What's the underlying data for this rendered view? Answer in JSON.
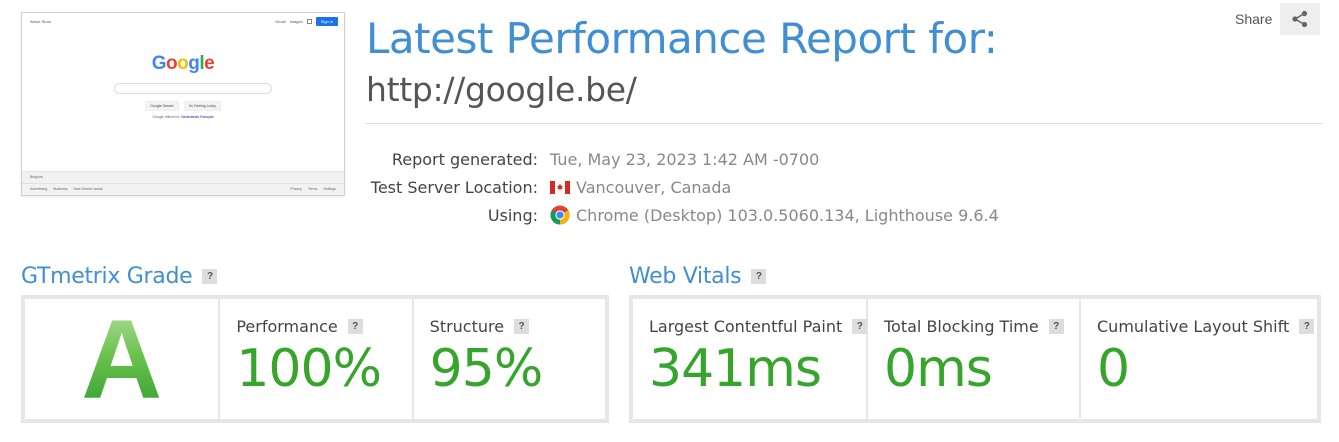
{
  "thumbnail": {
    "top_left_links": "About   Store",
    "top_right": {
      "gmail": "Gmail",
      "images": "Images",
      "signin": "Sign in"
    },
    "logo_letters": [
      {
        "ch": "G",
        "color": "#4285f4"
      },
      {
        "ch": "o",
        "color": "#ea4335"
      },
      {
        "ch": "o",
        "color": "#fbbc05"
      },
      {
        "ch": "g",
        "color": "#4285f4"
      },
      {
        "ch": "l",
        "color": "#34a853"
      },
      {
        "ch": "e",
        "color": "#ea4335"
      }
    ],
    "buttons": [
      "Google Search",
      "I'm Feeling Lucky"
    ],
    "offered_in": "Google offered in:",
    "offered_langs": "Nederlands   Français",
    "country": "Belgium",
    "footer_left": [
      "Advertising",
      "Business",
      "How Search works"
    ],
    "footer_right": [
      "Privacy",
      "Terms",
      "Settings"
    ]
  },
  "header": {
    "title": "Latest Performance Report for:",
    "url": "http://google.be/"
  },
  "share": {
    "label": "Share",
    "icon": "share-icon"
  },
  "meta": {
    "report_generated_label": "Report generated:",
    "report_generated_value": "Tue, May 23, 2023 1:42 AM -0700",
    "server_location_label": "Test Server Location:",
    "server_location_value": "Vancouver, Canada",
    "using_label": "Using:",
    "using_value": "Chrome (Desktop) 103.0.5060.134, Lighthouse 9.6.4"
  },
  "gtmetrix": {
    "title": "GTmetrix Grade",
    "grade": "A",
    "performance_label": "Performance",
    "performance_value": "100%",
    "structure_label": "Structure",
    "structure_value": "95%"
  },
  "web_vitals": {
    "title": "Web Vitals",
    "lcp_label": "Largest Contentful Paint",
    "lcp_value": "341ms",
    "tbt_label": "Total Blocking Time",
    "tbt_value": "0ms",
    "cls_label": "Cumulative Layout Shift",
    "cls_value": "0"
  },
  "help_glyph": "?",
  "colors": {
    "accent_blue": "#3f8fd2",
    "good_green": "#36a52c",
    "panel_grey": "#e6e6e6"
  }
}
